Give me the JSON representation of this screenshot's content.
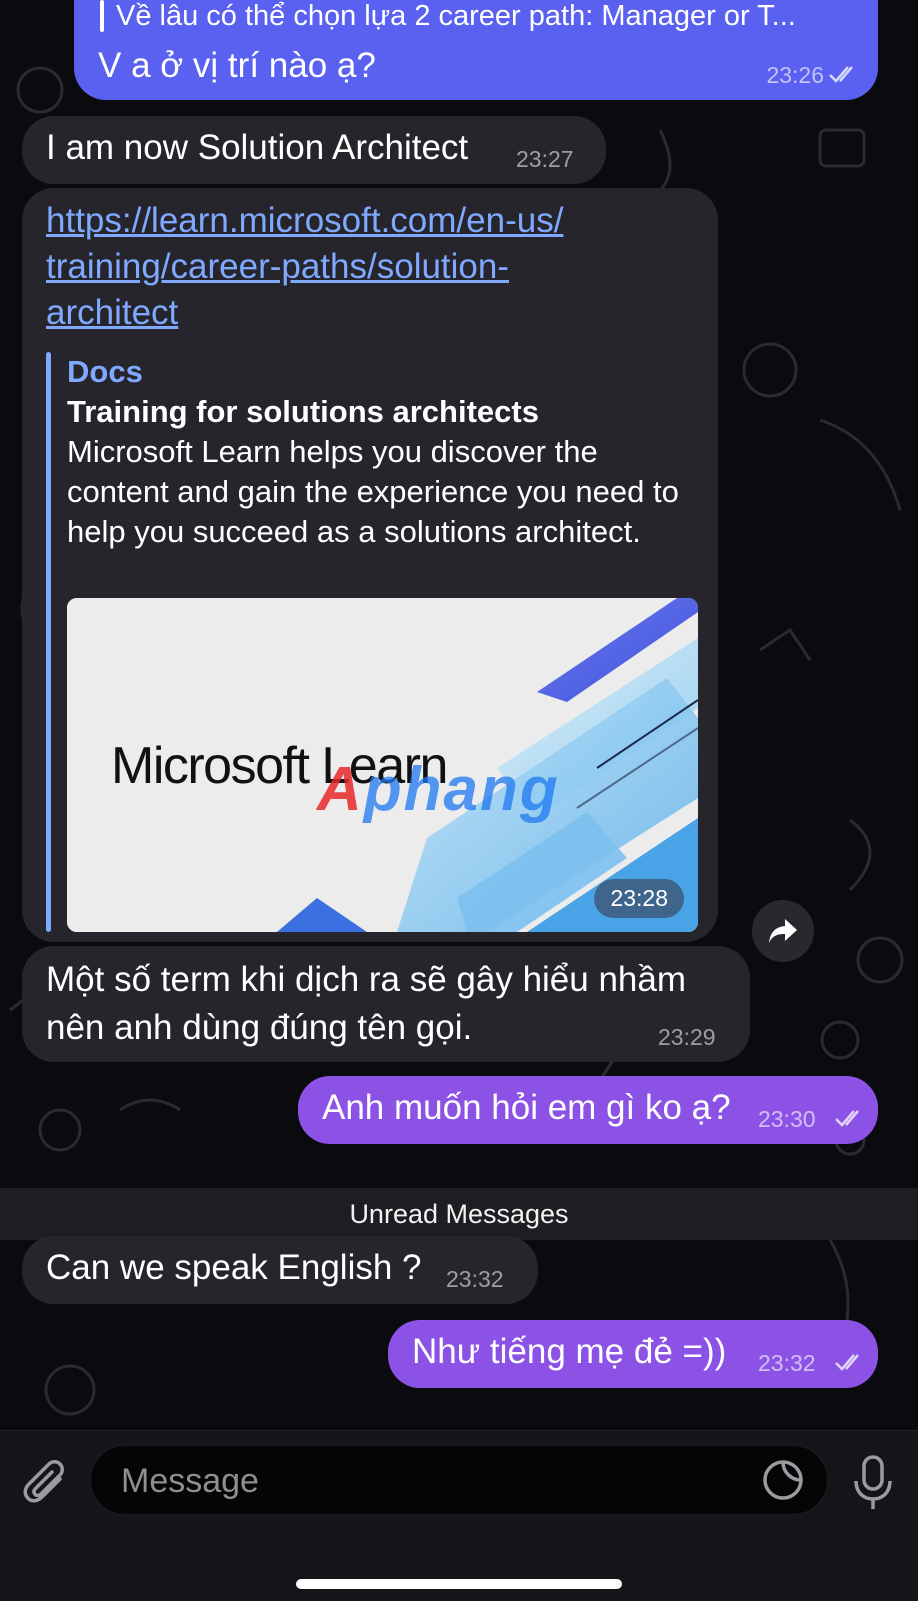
{
  "messages": [
    {
      "quote": "Về lâu có thể chọn lựa 2 career path: Manager or T...",
      "text": "V a ở vị trí nào ạ?",
      "time": "23:26"
    },
    {
      "text": "I am now Solution Architect",
      "time": "23:27"
    },
    {
      "link_lines": [
        "https://learn.microsoft.com/en-us/",
        "training/career-paths/solution-",
        "architect"
      ],
      "preview": {
        "site": "Docs",
        "title": "Training for solutions architects",
        "description": "Microsoft Learn helps you discover the content and gain the experience you need to help you succeed as a solutions architect.",
        "image_text": "Microsoft Learn",
        "watermark": "Aphang"
      },
      "time": "23:28"
    },
    {
      "text": "Một số term khi dịch ra sẽ gây hiểu nhầm nên anh dùng đúng tên gọi.",
      "time": "23:29"
    },
    {
      "text": "Anh muốn hỏi em gì ko ạ?",
      "time": "23:30"
    },
    {
      "text": "Can we speak English ?",
      "time": "23:32"
    },
    {
      "text": "Như tiếng mẹ đẻ =))",
      "time": "23:32"
    }
  ],
  "unread_label": "Unread Messages",
  "composer": {
    "placeholder": "Message"
  },
  "colors": {
    "background": "#0b0a0f",
    "incoming_bubble": "#27252c",
    "outgoing_blue": "#5a60f0",
    "outgoing_purple": "#8c52e6",
    "link": "#7fa9ff"
  },
  "icons": [
    "double-check-icon",
    "share-icon",
    "paperclip-icon",
    "sticker-icon",
    "microphone-icon"
  ]
}
